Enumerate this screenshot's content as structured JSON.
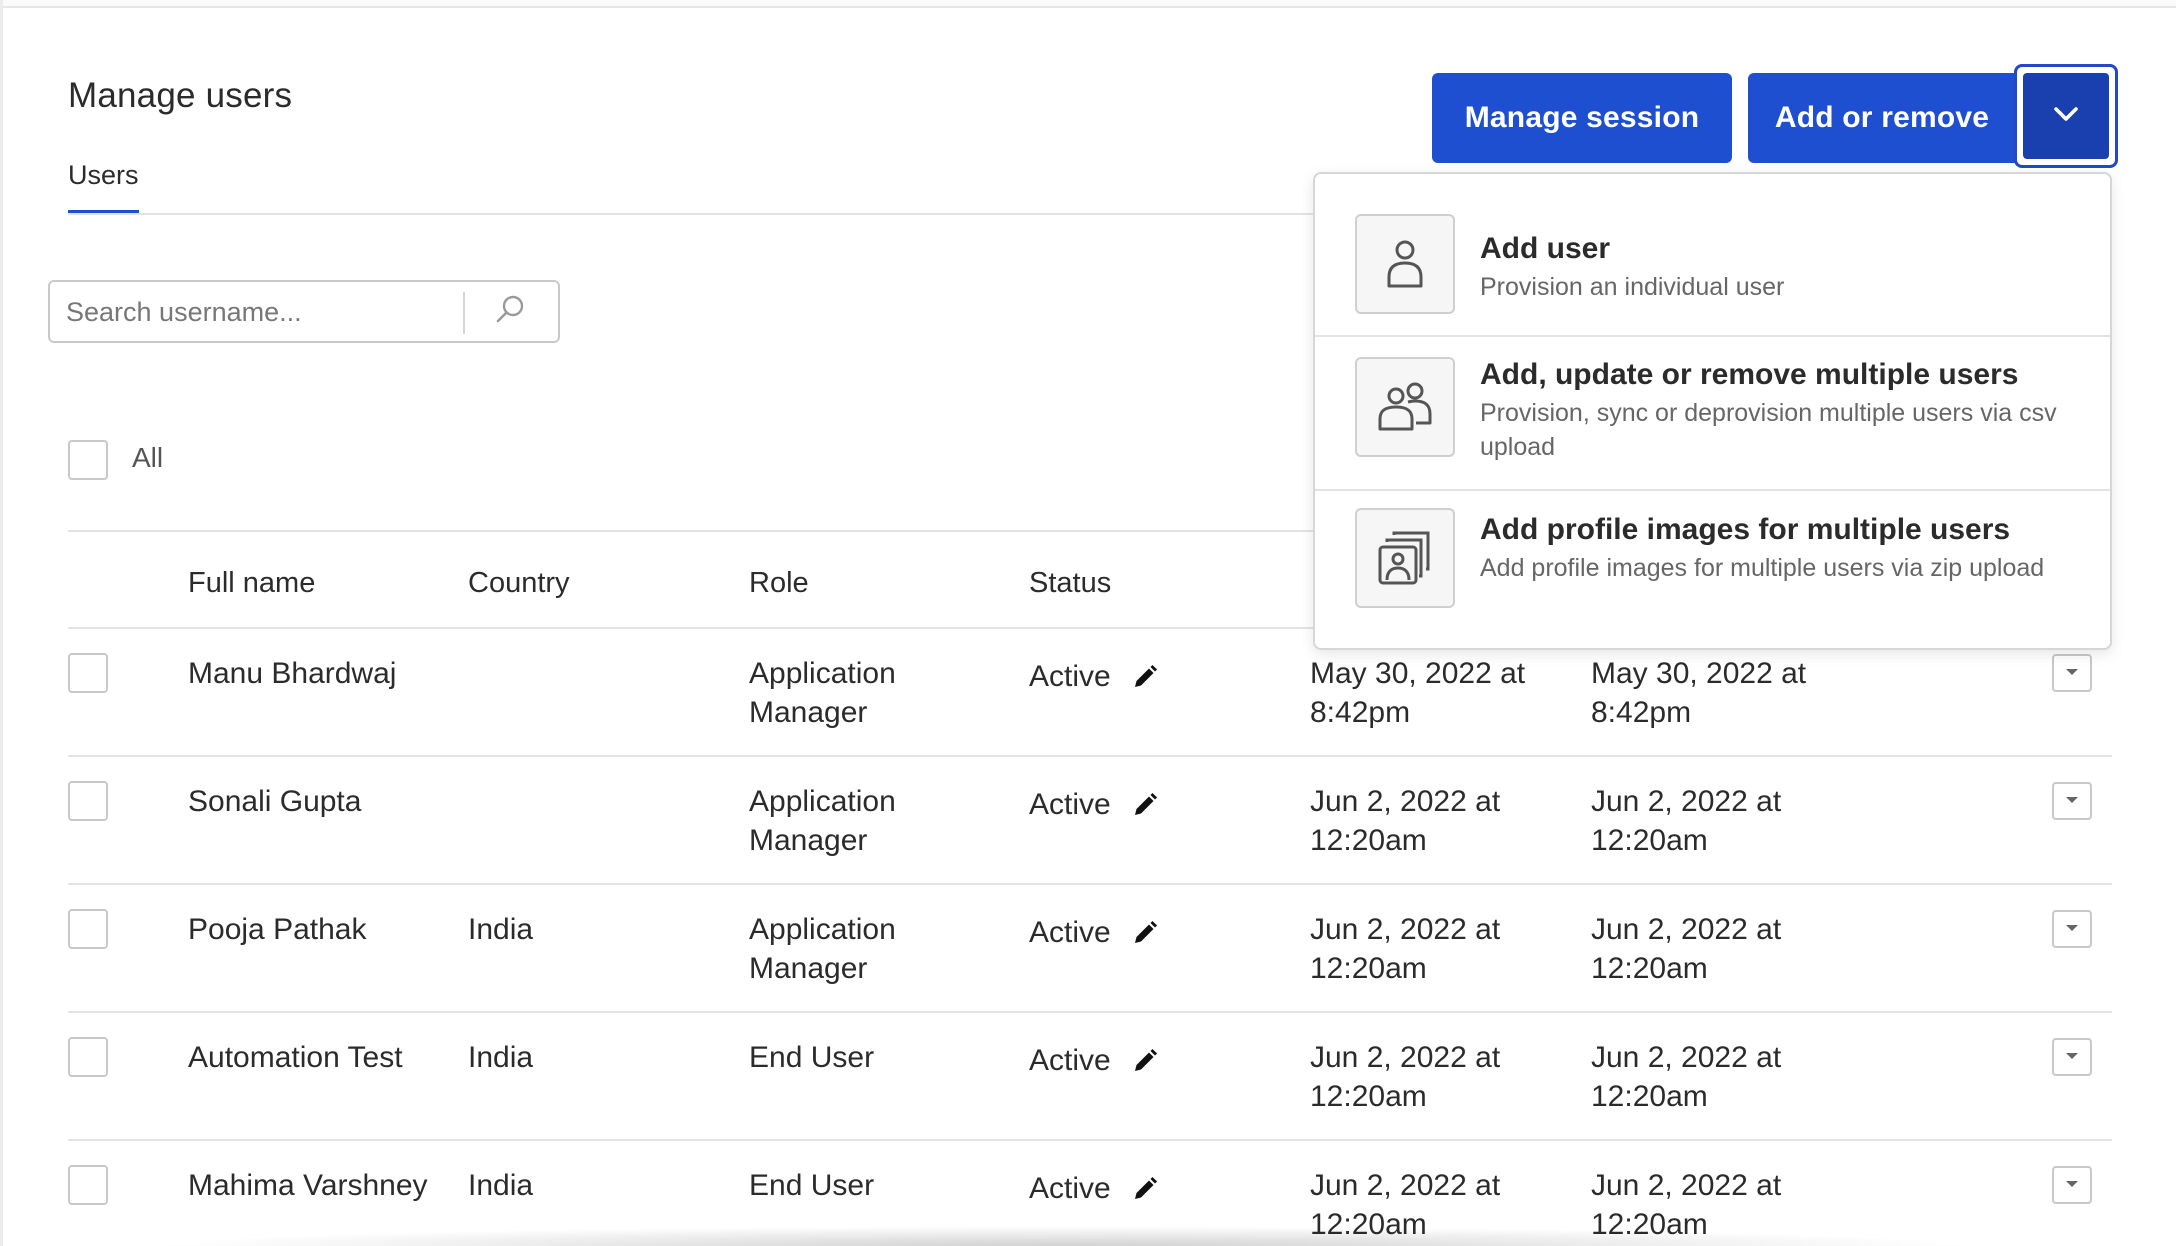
{
  "page": {
    "title": "Manage users",
    "tabs": [
      {
        "label": "Users",
        "active": true
      }
    ],
    "accent_color": "#1f4fd1"
  },
  "search": {
    "placeholder": "Search username...",
    "icon": "search-icon"
  },
  "select_all": {
    "label": "All"
  },
  "header_buttons": {
    "manage_session": "Manage session",
    "add_or_remove": "Add or remove",
    "toggle_icon": "chevron-down-icon"
  },
  "table": {
    "columns": [
      "Full name",
      "Country",
      "Role",
      "Status"
    ],
    "rows": [
      {
        "name": "Manu Bhardwaj",
        "country": "",
        "role": "Application Manager",
        "status": "Active",
        "date1": "May 30, 2022 at 8:42pm",
        "date2": "May 30, 2022 at 8:42pm"
      },
      {
        "name": "Sonali Gupta",
        "country": "",
        "role": "Application Manager",
        "status": "Active",
        "date1": "Jun 2, 2022 at 12:20am",
        "date2": "Jun 2, 2022 at 12:20am"
      },
      {
        "name": "Pooja Pathak",
        "country": "India",
        "role": "Application Manager",
        "status": "Active",
        "date1": "Jun 2, 2022 at 12:20am",
        "date2": "Jun 2, 2022 at 12:20am"
      },
      {
        "name": "Automation Test",
        "country": "India",
        "role": "End User",
        "status": "Active",
        "date1": "Jun 2, 2022 at 12:20am",
        "date2": "Jun 2, 2022 at 12:20am"
      },
      {
        "name": "Mahima Varshney",
        "country": "India",
        "role": "End User",
        "status": "Active",
        "date1": "Jun 2, 2022 at 12:20am",
        "date2": "Jun 2, 2022 at 12:20am"
      }
    ]
  },
  "dropdown": {
    "items": [
      {
        "title": "Add user",
        "description": "Provision an individual user",
        "icon": "user-icon"
      },
      {
        "title": "Add, update or remove multiple users",
        "description": "Provision, sync or deprovision multiple users via csv upload",
        "icon": "users-group-icon"
      },
      {
        "title": "Add profile images for multiple users",
        "description": "Add profile images for multiple users via zip upload",
        "icon": "profile-images-icon"
      }
    ]
  }
}
